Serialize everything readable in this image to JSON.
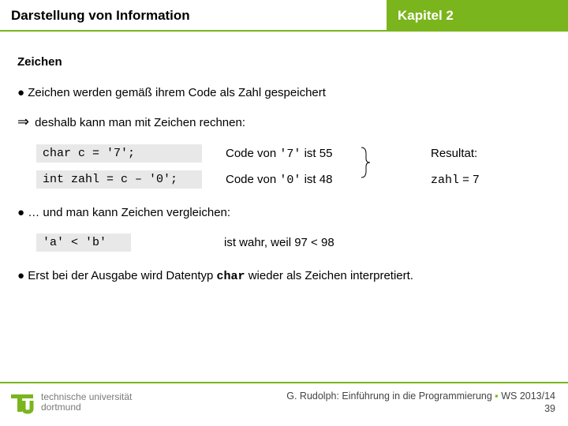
{
  "header": {
    "left": "Darstellung von Information",
    "right": "Kapitel 2"
  },
  "section_title": "Zeichen",
  "bullet1": "Zeichen werden gemäß ihrem Code als Zahl gespeichert",
  "implies_line": "deshalb kann man mit Zeichen rechnen:",
  "rows": [
    {
      "code": "char c = '7';",
      "desc_prefix": "Code von ",
      "desc_mono": "'7'",
      "desc_suffix": " ist 55",
      "result_label": "Resultat:"
    },
    {
      "code": "int zahl = c – '0';",
      "desc_prefix": "Code von ",
      "desc_mono": "'0'",
      "desc_suffix": " ist 48",
      "result_mono": "zahl",
      "result_suffix": " = 7"
    }
  ],
  "bullet2": "… und man kann Zeichen vergleichen:",
  "compare": {
    "code": "'a' < 'b'",
    "desc": "ist wahr, weil 97 < 98"
  },
  "bullet3_prefix": "Erst bei der Ausgabe wird Datentyp ",
  "bullet3_mono": "char",
  "bullet3_suffix": " wieder als Zeichen interpretiert.",
  "footer": {
    "uni1": "technische universität",
    "uni2": "dortmund",
    "credit_prefix": "G. Rudolph: Einführung in die Programmierung ",
    "credit_suffix": " WS 2013/14",
    "page": "39"
  },
  "chart_data": {
    "type": "table",
    "title": "ASCII character codes used in example",
    "rows": [
      {
        "char": "'7'",
        "code": 55
      },
      {
        "char": "'0'",
        "code": 48
      },
      {
        "char": "'a'",
        "code": 97
      },
      {
        "char": "'b'",
        "code": 98
      }
    ],
    "derived": {
      "expression": "zahl = c - '0'",
      "result": 7
    }
  }
}
